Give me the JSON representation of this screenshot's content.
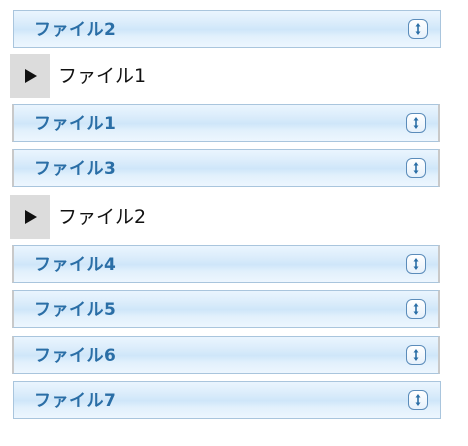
{
  "colors": {
    "item_text": "#2a6ea6",
    "item_border": "#a9c5dd",
    "group_toggle_bg": "#dcdcdc"
  },
  "items": [
    {
      "label": "ファイル2",
      "icon": "sort-icon"
    },
    {
      "label": "ファイル1",
      "icon": "sort-icon"
    },
    {
      "label": "ファイル3",
      "icon": "sort-icon"
    },
    {
      "label": "ファイル4",
      "icon": "sort-icon"
    },
    {
      "label": "ファイル5",
      "icon": "sort-icon"
    },
    {
      "label": "ファイル6",
      "icon": "sort-icon"
    },
    {
      "label": "ファイル7",
      "icon": "sort-icon"
    }
  ],
  "groups": [
    {
      "label": "ファイル1",
      "toggle_icon": "play-icon"
    },
    {
      "label": "ファイル2",
      "toggle_icon": "play-icon"
    }
  ]
}
